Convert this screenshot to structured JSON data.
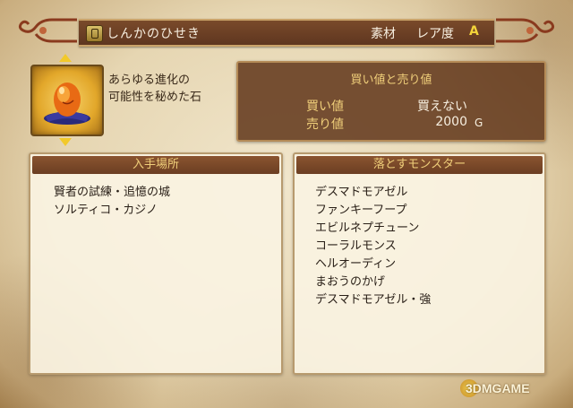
{
  "header": {
    "item_name": "しんかのひせき",
    "category": "素材",
    "rarity_label": "レア度",
    "rarity_value": "A"
  },
  "item": {
    "icon": "orange-egg-stone-icon",
    "description_line1": "あらゆる進化の",
    "description_line2": "可能性を秘めた石"
  },
  "prices": {
    "title": "買い値と売り値",
    "buy_label": "買い値",
    "buy_value": "買えない",
    "sell_label": "売り値",
    "sell_value": "2000",
    "currency": "G"
  },
  "locations": {
    "title": "入手場所",
    "items": [
      "賢者の試練・追憶の城",
      "ソルティコ・カジノ"
    ]
  },
  "monsters": {
    "title": "落とすモンスター",
    "items": [
      "デスマドモアゼル",
      "ファンキーフープ",
      "エビルネプチューン",
      "コーラルモンス",
      "ヘルオーディン",
      "まおうのかげ",
      "デスマドモアゼル・強"
    ]
  },
  "watermark": "3DMGAME",
  "colors": {
    "rarity": "#f3d43a",
    "panel_brown": "#643a1e",
    "gold_text": "#f0cf7a"
  }
}
